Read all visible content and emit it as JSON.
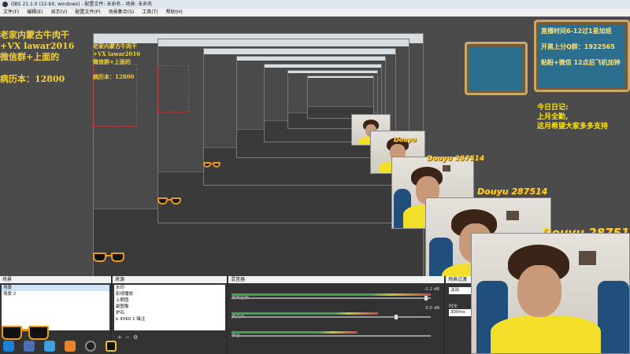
{
  "window": {
    "title": "OBS 21.1.0 (32-bit, windows) - 配置文件: 未命名 - 场景: 未命名"
  },
  "menu": [
    "文件(F)",
    "编辑(E)",
    "显示(V)",
    "配置文件(P)",
    "场景集合(S)",
    "工具(T)",
    "帮助(H)"
  ],
  "overlay": {
    "line1": "老家内蒙古牛肉干",
    "line2": "+VX lawar2016",
    "line3": "微信群+上面的",
    "line4": "病历本：12800"
  },
  "sign": {
    "line1": "直播时间6-12过1星加班",
    "line2": "开黑上分Q群：1922565",
    "line3": "粘粉+微信 12点后飞机加钟"
  },
  "diary": {
    "line1": "今日日记:",
    "line2": "上月全勤,",
    "line3": "这月希望大家多多支持"
  },
  "brand": {
    "douyu": "Douyu",
    "room": "287514"
  },
  "panels": {
    "scenes_title": "场景",
    "scenes": [
      "场景",
      "场景 2"
    ],
    "sources_title": "来源",
    "sources": [
      "水印",
      "影视播放",
      "上期图",
      "副图像",
      "护石",
      "b 4560 1 赌注"
    ],
    "mixer_title": "混音器",
    "mixer": [
      {
        "name": "桌面音频",
        "value": "-1.2 dB"
      },
      {
        "name": "麦克风",
        "value": "0.0 dB"
      },
      {
        "name": "录音",
        "value": ""
      }
    ],
    "transitions_title": "场景过渡",
    "transition_value": "淡出",
    "duration_label": "时长",
    "duration_value": "300ms"
  }
}
